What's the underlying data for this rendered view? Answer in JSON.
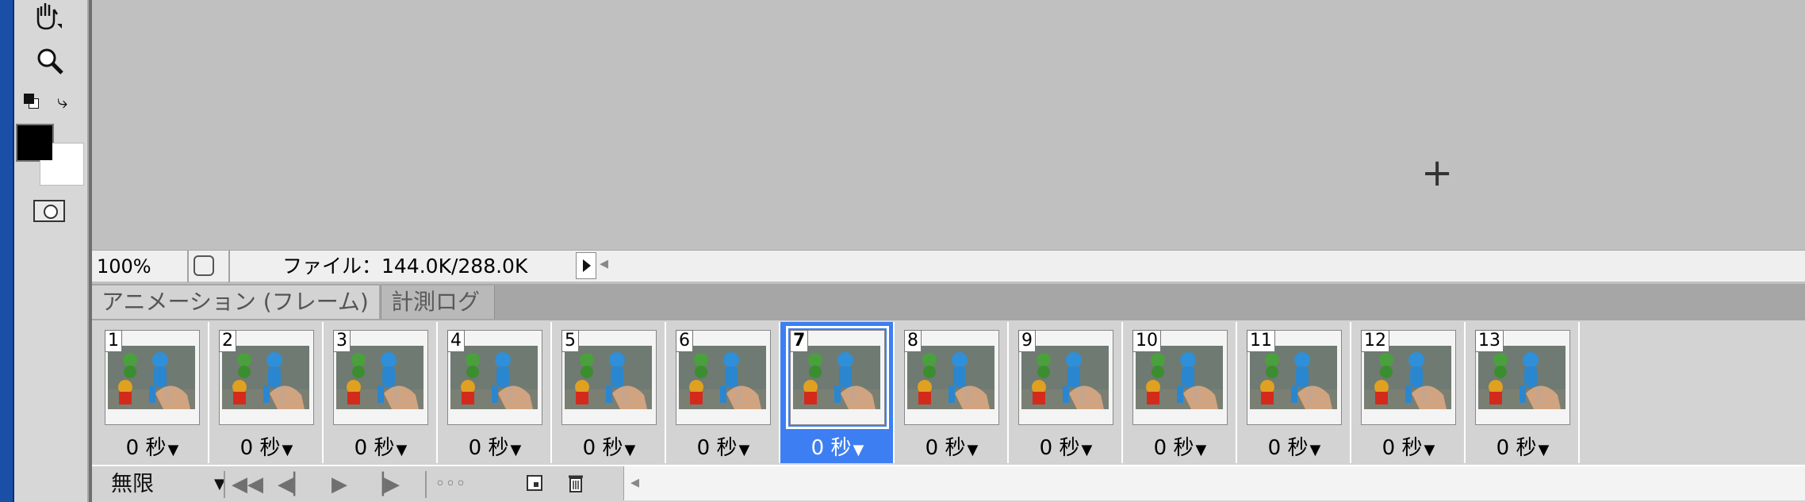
{
  "status": {
    "zoom": "100%",
    "file_info": "ファイル：144.0K/288.0K"
  },
  "panel": {
    "tabs": [
      {
        "label": "アニメーション (フレーム)",
        "active": true
      },
      {
        "label": "計測ログ",
        "active": false
      }
    ],
    "frames": [
      {
        "number": "1",
        "delay": "0 秒"
      },
      {
        "number": "2",
        "delay": "0 秒"
      },
      {
        "number": "3",
        "delay": "0 秒"
      },
      {
        "number": "4",
        "delay": "0 秒"
      },
      {
        "number": "5",
        "delay": "0 秒"
      },
      {
        "number": "6",
        "delay": "0 秒"
      },
      {
        "number": "7",
        "delay": "0 秒"
      },
      {
        "number": "8",
        "delay": "0 秒"
      },
      {
        "number": "9",
        "delay": "0 秒"
      },
      {
        "number": "10",
        "delay": "0 秒"
      },
      {
        "number": "11",
        "delay": "0 秒"
      },
      {
        "number": "12",
        "delay": "0 秒"
      },
      {
        "number": "13",
        "delay": "0 秒"
      }
    ],
    "selected_frame_number": "7",
    "loop_option": "無限"
  },
  "icons": {
    "tools": [
      "hand-icon",
      "zoom-icon",
      "default-colors-icon",
      "swap-colors-icon",
      "quick-mask-icon"
    ],
    "controls": [
      "first-frame-icon",
      "previous-frame-icon",
      "play-icon",
      "next-frame-icon",
      "tween-icon",
      "duplicate-frame-icon",
      "delete-frame-icon"
    ]
  },
  "colors": {
    "foreground": "#000000",
    "background": "#ffffff",
    "selection": "#3d7ff2"
  }
}
